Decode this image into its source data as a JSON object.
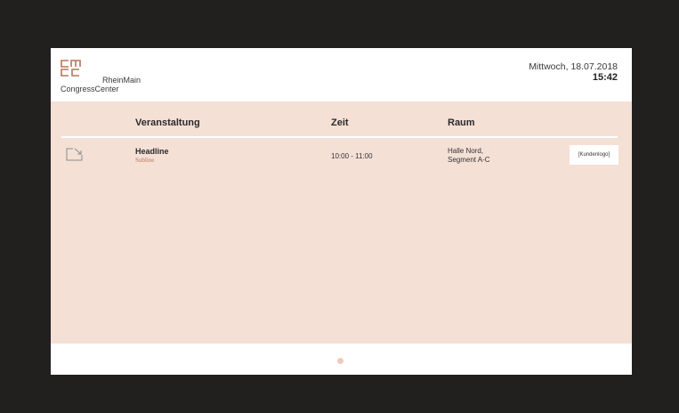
{
  "header": {
    "logo_line1": "RheinMain",
    "logo_line2": "CongressCenter",
    "date": "Mittwoch, 18.07.2018",
    "time": "15:42"
  },
  "table": {
    "columns": [
      "Veranstaltung",
      "Zeit",
      "Raum"
    ],
    "rows": [
      {
        "icon": "arrow-down-right-icon",
        "headline": "Headline",
        "subline": "Subline",
        "zeit": "10:00 - 11:00",
        "raum_line1": "Halle Nord,",
        "raum_line2": "Segment A-C",
        "kundenlogo": "[Kundenlogo]"
      }
    ]
  },
  "pagination": {
    "pages": 1,
    "current": 1
  },
  "colors": {
    "accent": "#b8755a",
    "content_bg": "#f5e0d6",
    "frame": "#221f1f",
    "dot": "#f0cabd"
  }
}
